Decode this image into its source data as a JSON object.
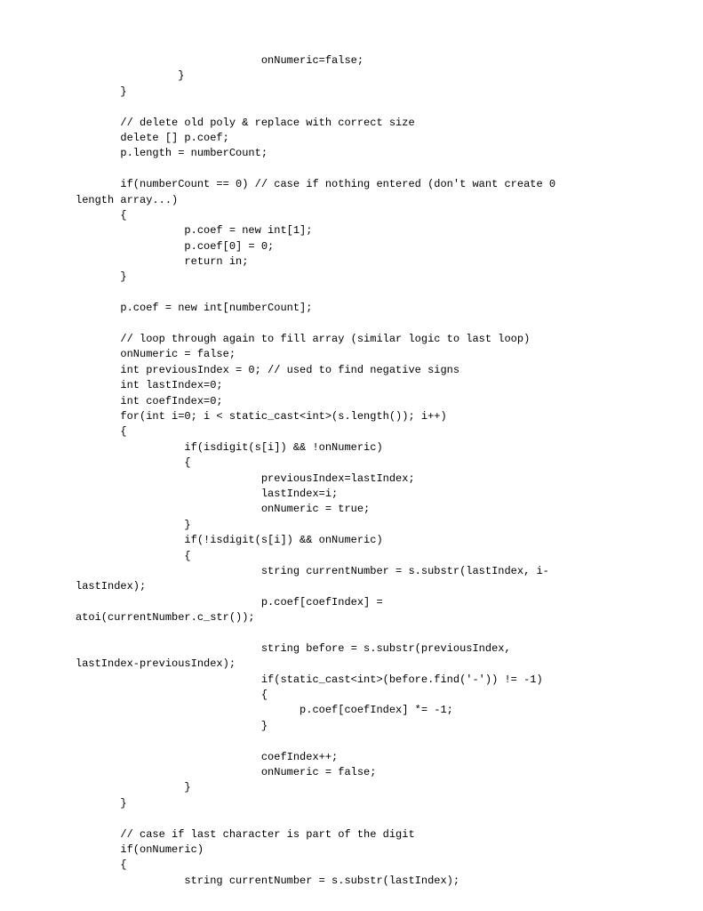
{
  "code": "                             onNumeric=false;\n                }\n       }\n\n       // delete old poly & replace with correct size\n       delete [] p.coef;\n       p.length = numberCount;\n\n       if(numberCount == 0) // case if nothing entered (don't want create 0\nlength array...)\n       {\n                 p.coef = new int[1];\n                 p.coef[0] = 0;\n                 return in;\n       }\n\n       p.coef = new int[numberCount];\n\n       // loop through again to fill array (similar logic to last loop)\n       onNumeric = false;\n       int previousIndex = 0; // used to find negative signs\n       int lastIndex=0;\n       int coefIndex=0;\n       for(int i=0; i < static_cast<int>(s.length()); i++)\n       {\n                 if(isdigit(s[i]) && !onNumeric)\n                 {\n                             previousIndex=lastIndex;\n                             lastIndex=i;\n                             onNumeric = true;\n                 }\n                 if(!isdigit(s[i]) && onNumeric)\n                 {\n                             string currentNumber = s.substr(lastIndex, i-\nlastIndex);\n                             p.coef[coefIndex] =\natoi(currentNumber.c_str());\n\n                             string before = s.substr(previousIndex,\nlastIndex-previousIndex);\n                             if(static_cast<int>(before.find('-')) != -1)\n                             {\n                                   p.coef[coefIndex] *= -1;\n                             }\n\n                             coefIndex++;\n                             onNumeric = false;\n                 }\n       }\n\n       // case if last character is part of the digit\n       if(onNumeric)\n       {\n                 string currentNumber = s.substr(lastIndex);"
}
